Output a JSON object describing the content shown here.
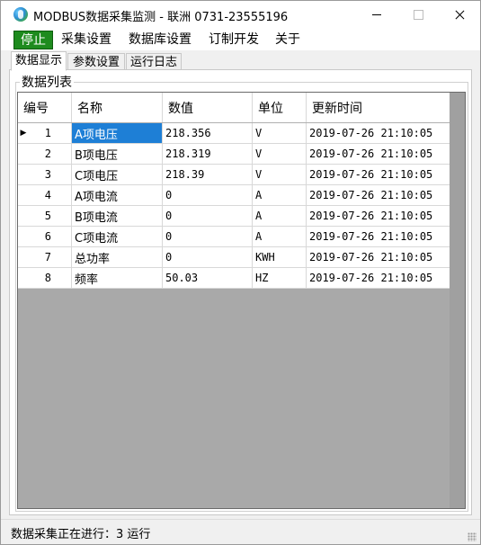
{
  "window": {
    "title": "MODBUS数据采集监测 - 联洲 0731-23555196"
  },
  "menu": {
    "stop_label": "停止",
    "items": [
      {
        "label": "采集设置"
      },
      {
        "label": "数据库设置"
      },
      {
        "label": "订制开发"
      },
      {
        "label": "关于"
      }
    ]
  },
  "tabs": [
    {
      "label": "数据显示",
      "active": true
    },
    {
      "label": "参数设置",
      "active": false
    },
    {
      "label": "运行日志",
      "active": false
    }
  ],
  "group": {
    "title": "数据列表"
  },
  "grid": {
    "columns": [
      "编号",
      "名称",
      "数值",
      "单位",
      "更新时间"
    ],
    "selected_row": 1,
    "rows": [
      {
        "id": "1",
        "name": "A项电压",
        "value": "218.356",
        "unit": "V",
        "time": "2019-07-26 21:10:05"
      },
      {
        "id": "2",
        "name": "B项电压",
        "value": "218.319",
        "unit": "V",
        "time": "2019-07-26 21:10:05"
      },
      {
        "id": "3",
        "name": "C项电压",
        "value": "218.39",
        "unit": "V",
        "time": "2019-07-26 21:10:05"
      },
      {
        "id": "4",
        "name": "A项电流",
        "value": "0",
        "unit": "A",
        "time": "2019-07-26 21:10:05"
      },
      {
        "id": "5",
        "name": "B项电流",
        "value": "0",
        "unit": "A",
        "time": "2019-07-26 21:10:05"
      },
      {
        "id": "6",
        "name": "C项电流",
        "value": "0",
        "unit": "A",
        "time": "2019-07-26 21:10:05"
      },
      {
        "id": "7",
        "name": "总功率",
        "value": "0",
        "unit": "KWH",
        "time": "2019-07-26 21:10:05"
      },
      {
        "id": "8",
        "name": "频率",
        "value": "50.03",
        "unit": "HZ",
        "time": "2019-07-26 21:10:05"
      }
    ]
  },
  "status": {
    "text": "数据采集正在进行：3 运行"
  },
  "icons": {
    "app": "app-icon",
    "row_pointer": "row-pointer-icon",
    "grip": "resize-grip-icon"
  },
  "colors": {
    "stop_bg": "#1e8b1e",
    "selection": "#1e7fd6",
    "grid_bg": "#a9a9a9"
  }
}
